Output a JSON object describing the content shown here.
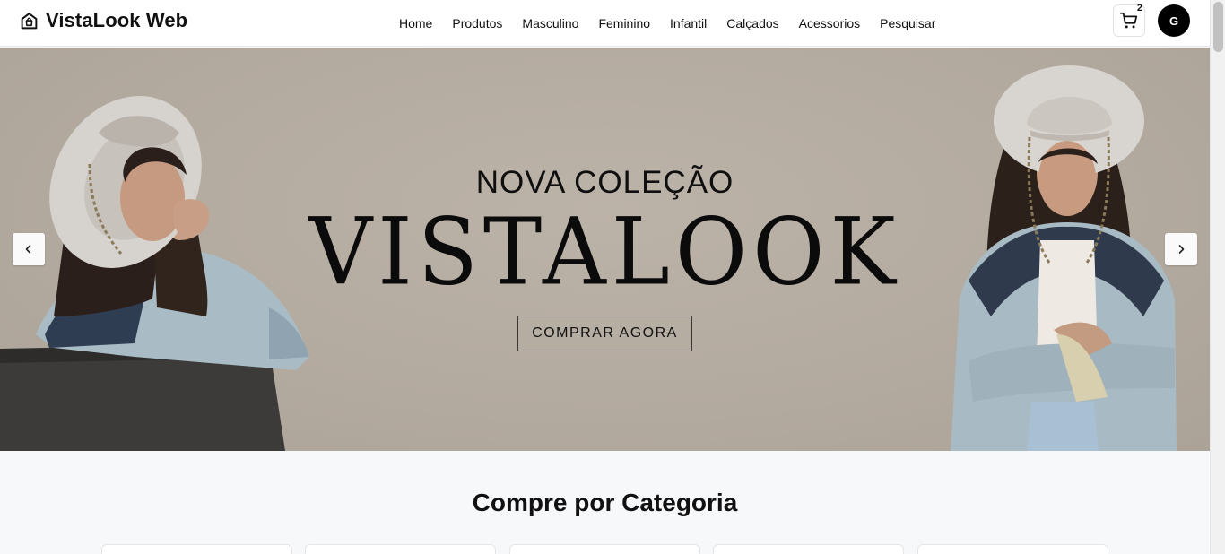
{
  "brand": {
    "name": "VistaLook Web",
    "icon": "home-bag-icon"
  },
  "nav": {
    "items": [
      "Home",
      "Produtos",
      "Masculino",
      "Feminino",
      "Infantil",
      "Calçados",
      "Acessorios",
      "Pesquisar"
    ]
  },
  "cart": {
    "icon": "cart-icon",
    "count": "2"
  },
  "user": {
    "initial": "G"
  },
  "hero": {
    "eyebrow": "NOVA COLEÇÃO",
    "title": "VISTALOOK",
    "cta": "COMPRAR AGORA",
    "prev_icon": "chevron-left-icon",
    "next_icon": "chevron-right-icon",
    "background": "#b5aca1"
  },
  "categories": {
    "title": "Compre por Categoria"
  },
  "colors": {
    "accent": "#000000",
    "page_bg": "#f7f8fa"
  }
}
